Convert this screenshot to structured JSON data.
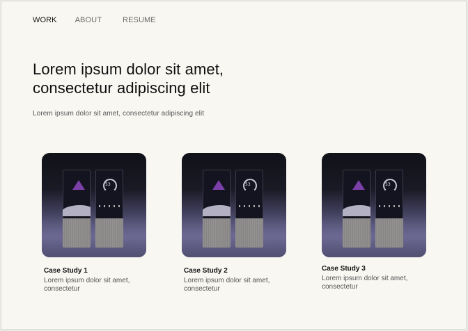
{
  "nav": {
    "items": [
      {
        "label": "WORK",
        "active": true
      },
      {
        "label": "ABOUT",
        "active": false
      },
      {
        "label": "RESUME",
        "active": false
      }
    ]
  },
  "hero": {
    "title": "Lorem ipsum dolor sit amet, consectetur adipiscing elit",
    "subtitle": "Lorem ipsum dolor sit amet, consectetur adipiscing elit"
  },
  "cards": [
    {
      "title": "Case Study 1",
      "description": "Lorem ipsum dolor sit amet, consectetur",
      "gauge_value": "53"
    },
    {
      "title": "Case Study 2",
      "description": "Lorem ipsum dolor sit amet, consectetur",
      "gauge_value": "53"
    },
    {
      "title": "Case Study 3",
      "description": "Lorem ipsum dolor sit amet, consectetur",
      "gauge_value": "53"
    }
  ],
  "colors": {
    "background": "#f8f7f2",
    "accent_purple": "#7b3fa8",
    "text_primary": "#111111",
    "text_secondary": "#555555"
  }
}
